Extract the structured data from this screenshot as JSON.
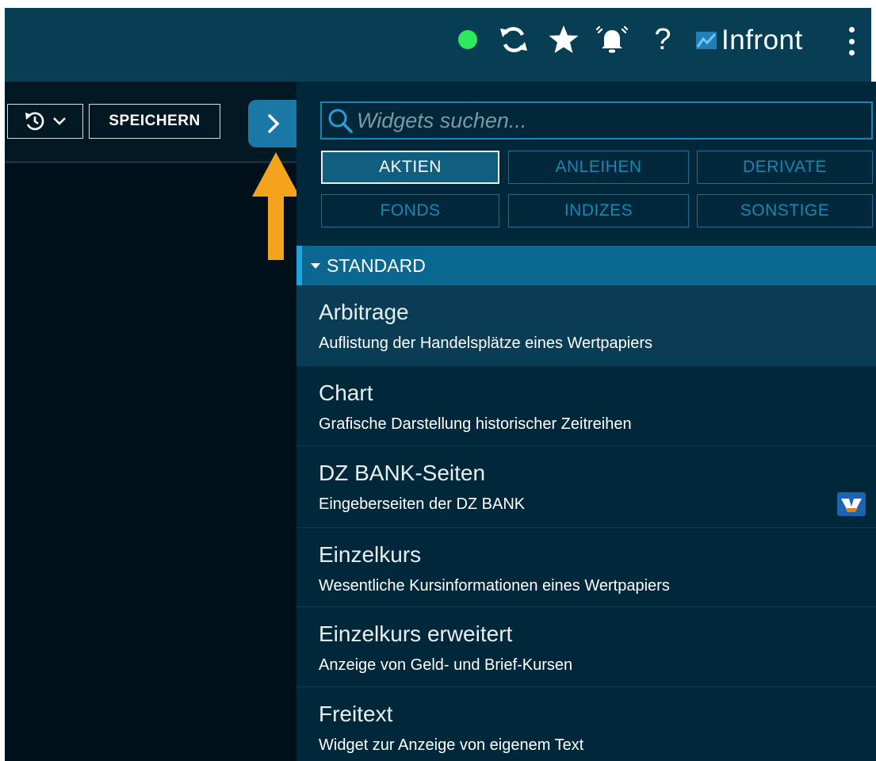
{
  "header": {
    "brand": "Infront",
    "status": "online",
    "status_color": "#2ee85e",
    "icons": [
      "status-dot-icon",
      "refresh-icon",
      "star-icon",
      "bell-icon",
      "help-icon",
      "infront-logo-icon",
      "kebab-menu-icon"
    ],
    "help_glyph": "?"
  },
  "toolbar": {
    "history_icon": "history-icon",
    "save_label": "SPEICHERN",
    "expand_icon": "chevron-right-icon"
  },
  "panel": {
    "search": {
      "placeholder": "Widgets suchen...",
      "value": ""
    },
    "tabs": [
      {
        "label": "AKTIEN",
        "active": true
      },
      {
        "label": "ANLEIHEN",
        "active": false
      },
      {
        "label": "DERIVATE",
        "active": false
      },
      {
        "label": "FONDS",
        "active": false
      },
      {
        "label": "INDIZES",
        "active": false
      },
      {
        "label": "SONSTIGE",
        "active": false
      }
    ],
    "section": {
      "title": "STANDARD",
      "expanded": true
    },
    "widgets": [
      {
        "title": "Arbitrage",
        "description": "Auflistung der Handelsplätze eines Wertpapiers",
        "selected": true
      },
      {
        "title": "Chart",
        "description": "Grafische Darstellung historischer Zeitreihen"
      },
      {
        "title": "DZ BANK-Seiten",
        "description": "Eingeberseiten der DZ BANK",
        "badge_icon": "dz-bank-logo-icon"
      },
      {
        "title": "Einzelkurs",
        "description": "Wesentliche Kursinformationen eines Wertpapiers"
      },
      {
        "title": "Einzelkurs erweitert",
        "description": "Anzeige von Geld- und Brief-Kursen"
      },
      {
        "title": "Freitext",
        "description": "Widget zur Anzeige von eigenem Text"
      }
    ]
  },
  "colors": {
    "topbar": "#073e54",
    "accent_blue": "#1a78a6",
    "panel_bg": "#00283a",
    "annotation_arrow": "#f4a31c"
  }
}
